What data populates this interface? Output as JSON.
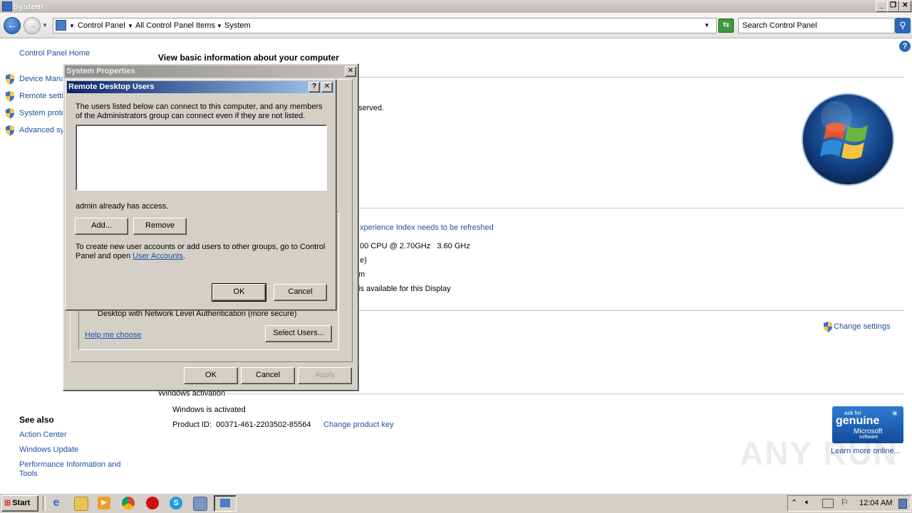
{
  "window": {
    "title": "System"
  },
  "address": {
    "crumbs": [
      "Control Panel",
      "All Control Panel Items",
      "System"
    ],
    "search_placeholder": "Search Control Panel"
  },
  "sidebar": {
    "home": "Control Panel Home",
    "items": [
      "Device Mana",
      "Remote setti",
      "System prote",
      "Advanced sy"
    ],
    "see_also_title": "See also",
    "see_also": [
      "Action Center",
      "Windows Update",
      "Performance Information and Tools"
    ]
  },
  "main": {
    "heading": "View basic information about your computer",
    "reserved_text": "served.",
    "experience_link": "xperience Index needs to be refreshed",
    "cpu_text": "00 CPU @ 2.70GHz   3.60 GHz",
    "ram_text": "e)",
    "type_text": "m",
    "pen_text": "is available for this Display",
    "change_settings": "Change settings",
    "activation_label": "Windows activation",
    "activated": "Windows is activated",
    "product_id": "Product ID:  00371-461-2203502-85564",
    "change_key": "Change product key",
    "genuine_line1": "ask for",
    "genuine_line2": "genuine",
    "genuine_line3": "Microsoft",
    "genuine_line4": "software",
    "learn_more": "Learn more online..."
  },
  "sysprops": {
    "title": "System Properties",
    "nla_text": "Desktop with Network Level Authentication (more secure)",
    "help_link": "Help me choose",
    "select_users": "Select Users...",
    "ok": "OK",
    "cancel": "Cancel",
    "apply": "Apply"
  },
  "rdu": {
    "title": "Remote Desktop Users",
    "help_glyph": "?",
    "close_glyph": "✕",
    "intro": "The users listed below can connect to this computer, and any members of the Administrators group can connect even if they are not listed.",
    "access_text": "admin already has access.",
    "add": "Add...",
    "remove": "Remove",
    "footer_prefix": "To create new user accounts or add users to other groups, go to Control Panel and open ",
    "footer_link": "User Accounts",
    "footer_suffix": ".",
    "ok": "OK",
    "cancel": "Cancel"
  },
  "taskbar": {
    "start": "Start",
    "clock": "12:04 AM"
  },
  "watermark": "ANY RUN",
  "colors": {
    "link": "#1e50a0",
    "dialog": "#d4d0c8",
    "titlebar_active": "#0a246a"
  }
}
